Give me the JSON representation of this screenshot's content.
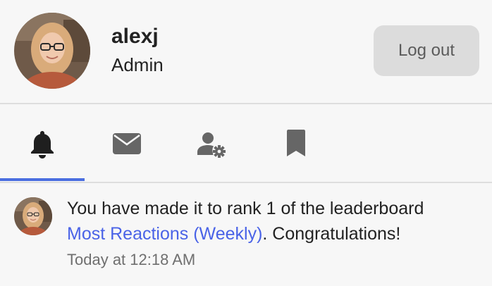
{
  "user": {
    "username": "alexj",
    "role": "Admin",
    "logout_label": "Log out"
  },
  "tabs": [
    {
      "icon": "bell-icon",
      "active": true
    },
    {
      "icon": "envelope-icon",
      "active": false
    },
    {
      "icon": "user-settings-icon",
      "active": false
    },
    {
      "icon": "bookmark-icon",
      "active": false
    }
  ],
  "notification": {
    "text_before": "You have made it to rank 1 of the leaderboard",
    "link_text": "Most Reactions (Weekly)",
    "text_after": ". Congratulations!",
    "time": "Today at 12:18 AM"
  },
  "colors": {
    "accent": "#4a6ee0",
    "link": "#4a63e7",
    "active_icon": "#1f1f1f",
    "inactive_icon": "#666666"
  }
}
